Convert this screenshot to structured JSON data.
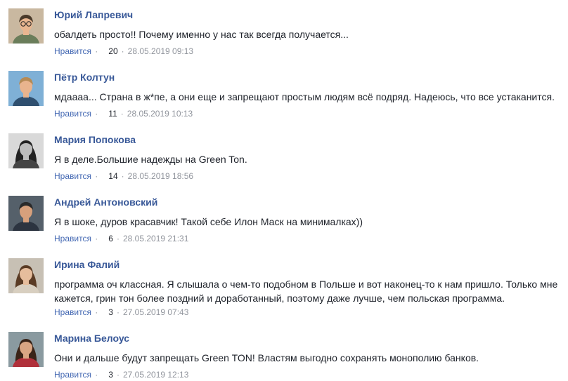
{
  "comments": [
    {
      "author": "Юрий Лапревич",
      "text": "обалдеть просто!! Почему именно у нас так всегда получается...",
      "like_label": "Нравится",
      "separator": "·",
      "likes": "20",
      "date": "28.05.2019 09:13",
      "avatar_icon": "avatar-man-glasses-icon",
      "avatar_colors": {
        "bg": "#c9b8a0",
        "skin": "#e8b690",
        "hair": "#4a3a2a",
        "shirt": "#6a7d5a"
      }
    },
    {
      "author": "Пётр Колтун",
      "text": "мдаааа... Страна в ж*пе, а они еще и запрещают простым людям всё подряд. Надеюсь, что все устаканится.",
      "like_label": "Нравится",
      "separator": "·",
      "likes": "11",
      "date": "28.05.2019 10:13",
      "avatar_icon": "avatar-man-icon",
      "avatar_colors": {
        "bg": "#7fb0d6",
        "skin": "#e9b48e",
        "hair": "#b58a55",
        "shirt": "#2f4f6f"
      }
    },
    {
      "author": "Мария Попокова",
      "text": "Я в деле.Большие надежды на Green Ton.",
      "like_label": "Нравится",
      "separator": "·",
      "likes": "14",
      "date": "28.05.2019 18:56",
      "avatar_icon": "avatar-woman-icon",
      "avatar_colors": {
        "bg": "#d9d9d9",
        "skin": "#bdbdbd",
        "hair": "#222222",
        "shirt": "#444444"
      }
    },
    {
      "author": "Андрей Антоновский",
      "text": "Я в шоке, дуров красавчик! Такой себе Илон Маск на минималках))",
      "like_label": "Нравится",
      "separator": "·",
      "likes": "6",
      "date": "28.05.2019 21:31",
      "avatar_icon": "avatar-man-icon",
      "avatar_colors": {
        "bg": "#55606a",
        "skin": "#d7a07c",
        "hair": "#2a2a2a",
        "shirt": "#2c3440"
      }
    },
    {
      "author": "Ирина Фалий",
      "text": "программа оч классная. Я слышала о чем-то подобном в Польше и вот наконец-то к нам пришло. Только мне кажется, грин тон более поздний и доработанный, поэтому даже лучше, чем польская программа.",
      "like_label": "Нравится",
      "separator": "·",
      "likes": "3",
      "date": "27.05.2019 07:43",
      "avatar_icon": "avatar-woman-icon",
      "avatar_colors": {
        "bg": "#c7c0b4",
        "skin": "#e6bd9c",
        "hair": "#5a3b24",
        "shirt": "#d8cfc0"
      }
    },
    {
      "author": "Марина Белоус",
      "text": "Они и дальше будут запрещать Green TON! Властям выгодно сохранять монополию банков.",
      "like_label": "Нравится",
      "separator": "·",
      "likes": "3",
      "date": "27.05.2019 12:13",
      "avatar_icon": "avatar-woman-icon",
      "avatar_colors": {
        "bg": "#8a9aa0",
        "skin": "#d9a583",
        "hair": "#3a2418",
        "shirt": "#b0303a"
      }
    }
  ]
}
